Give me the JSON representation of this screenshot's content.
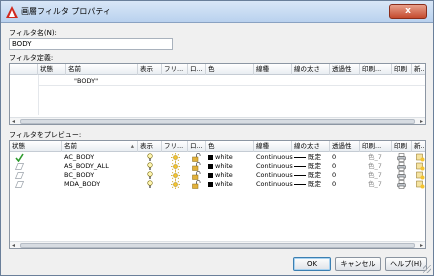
{
  "window": {
    "title": "画層フィルタ プロパティ",
    "close_label": "x"
  },
  "filter_name": {
    "label": "フィルタ名(N):",
    "value": "BODY"
  },
  "definition": {
    "label": "フィルタ定義:",
    "columns": [
      "状態",
      "名前",
      "表示",
      "フリ...",
      "ロ...",
      "色",
      "線種",
      "線の太さ",
      "透過性",
      "印刷...",
      "印刷",
      "新..."
    ],
    "rows": [
      {
        "name": "\"BODY\""
      }
    ]
  },
  "preview": {
    "label": "フィルタをプレビュー:",
    "columns": [
      "状態",
      "名前",
      "表示",
      "フリ...",
      "ロ...",
      "色",
      "線種",
      "線の太さ",
      "透過性",
      "印刷...",
      "印刷",
      "新..."
    ],
    "rows": [
      {
        "name": "AC_BODY",
        "color": "white",
        "linetype": "Continuous",
        "lineweight": "既定",
        "transparency": "0",
        "plotstyle": "色_7"
      },
      {
        "name": "AS_BODY_ALL",
        "color": "white",
        "linetype": "Continuous",
        "lineweight": "既定",
        "transparency": "0",
        "plotstyle": "色_7"
      },
      {
        "name": "BC_BODY",
        "color": "white",
        "linetype": "Continuous",
        "lineweight": "既定",
        "transparency": "0",
        "plotstyle": "色_7"
      },
      {
        "name": "MDA_BODY",
        "color": "white",
        "linetype": "Continuous",
        "lineweight": "既定",
        "transparency": "0",
        "plotstyle": "色_7"
      }
    ]
  },
  "buttons": {
    "ok": "OK",
    "cancel": "キャンセル",
    "help": "ヘルプ(H)"
  },
  "colors": {
    "current_check": "#2e9b2e",
    "title_bar": "#c8dbf2",
    "close": "#c44a2e"
  }
}
